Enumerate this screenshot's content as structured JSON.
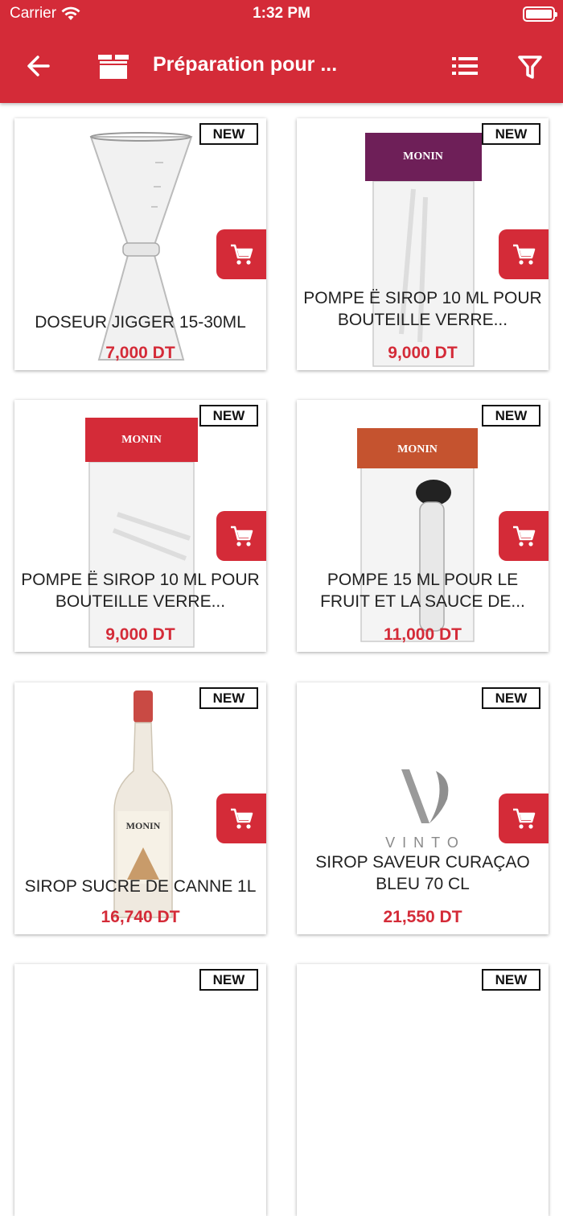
{
  "status_bar": {
    "carrier": "Carrier",
    "time": "1:32 PM"
  },
  "header": {
    "title": "Préparation pour ..."
  },
  "colors": {
    "accent": "#d42b38",
    "price": "#d42b38"
  },
  "products": [
    {
      "badge": "NEW",
      "name": "DOSEUR JIGGER 15-30ML",
      "price": "7,000 DT"
    },
    {
      "badge": "NEW",
      "name": "POMPE Ë SIROP 10 ML POUR BOUTEILLE VERRE...",
      "price": "9,000 DT"
    },
    {
      "badge": "NEW",
      "name": "POMPE Ë SIROP 10 ML POUR BOUTEILLE VERRE...",
      "price": "9,000 DT"
    },
    {
      "badge": "NEW",
      "name": "POMPE 15 ML POUR LE FRUIT ET LA SAUCE DE...",
      "price": "11,000 DT"
    },
    {
      "badge": "NEW",
      "name": "SIROP SUCRE DE CANNE 1L",
      "price": "16,740 DT"
    },
    {
      "badge": "NEW",
      "name": "SIROP SAVEUR CURAÇAO BLEU 70 CL",
      "price": "21,550 DT"
    },
    {
      "badge": "NEW"
    },
    {
      "badge": "NEW"
    }
  ],
  "images": {
    "p2_brand": "MONIN",
    "p3_brand": "MONIN",
    "p4_brand": "MONIN",
    "p5_brand": "MONIN",
    "p6_logo": "VINTO"
  }
}
